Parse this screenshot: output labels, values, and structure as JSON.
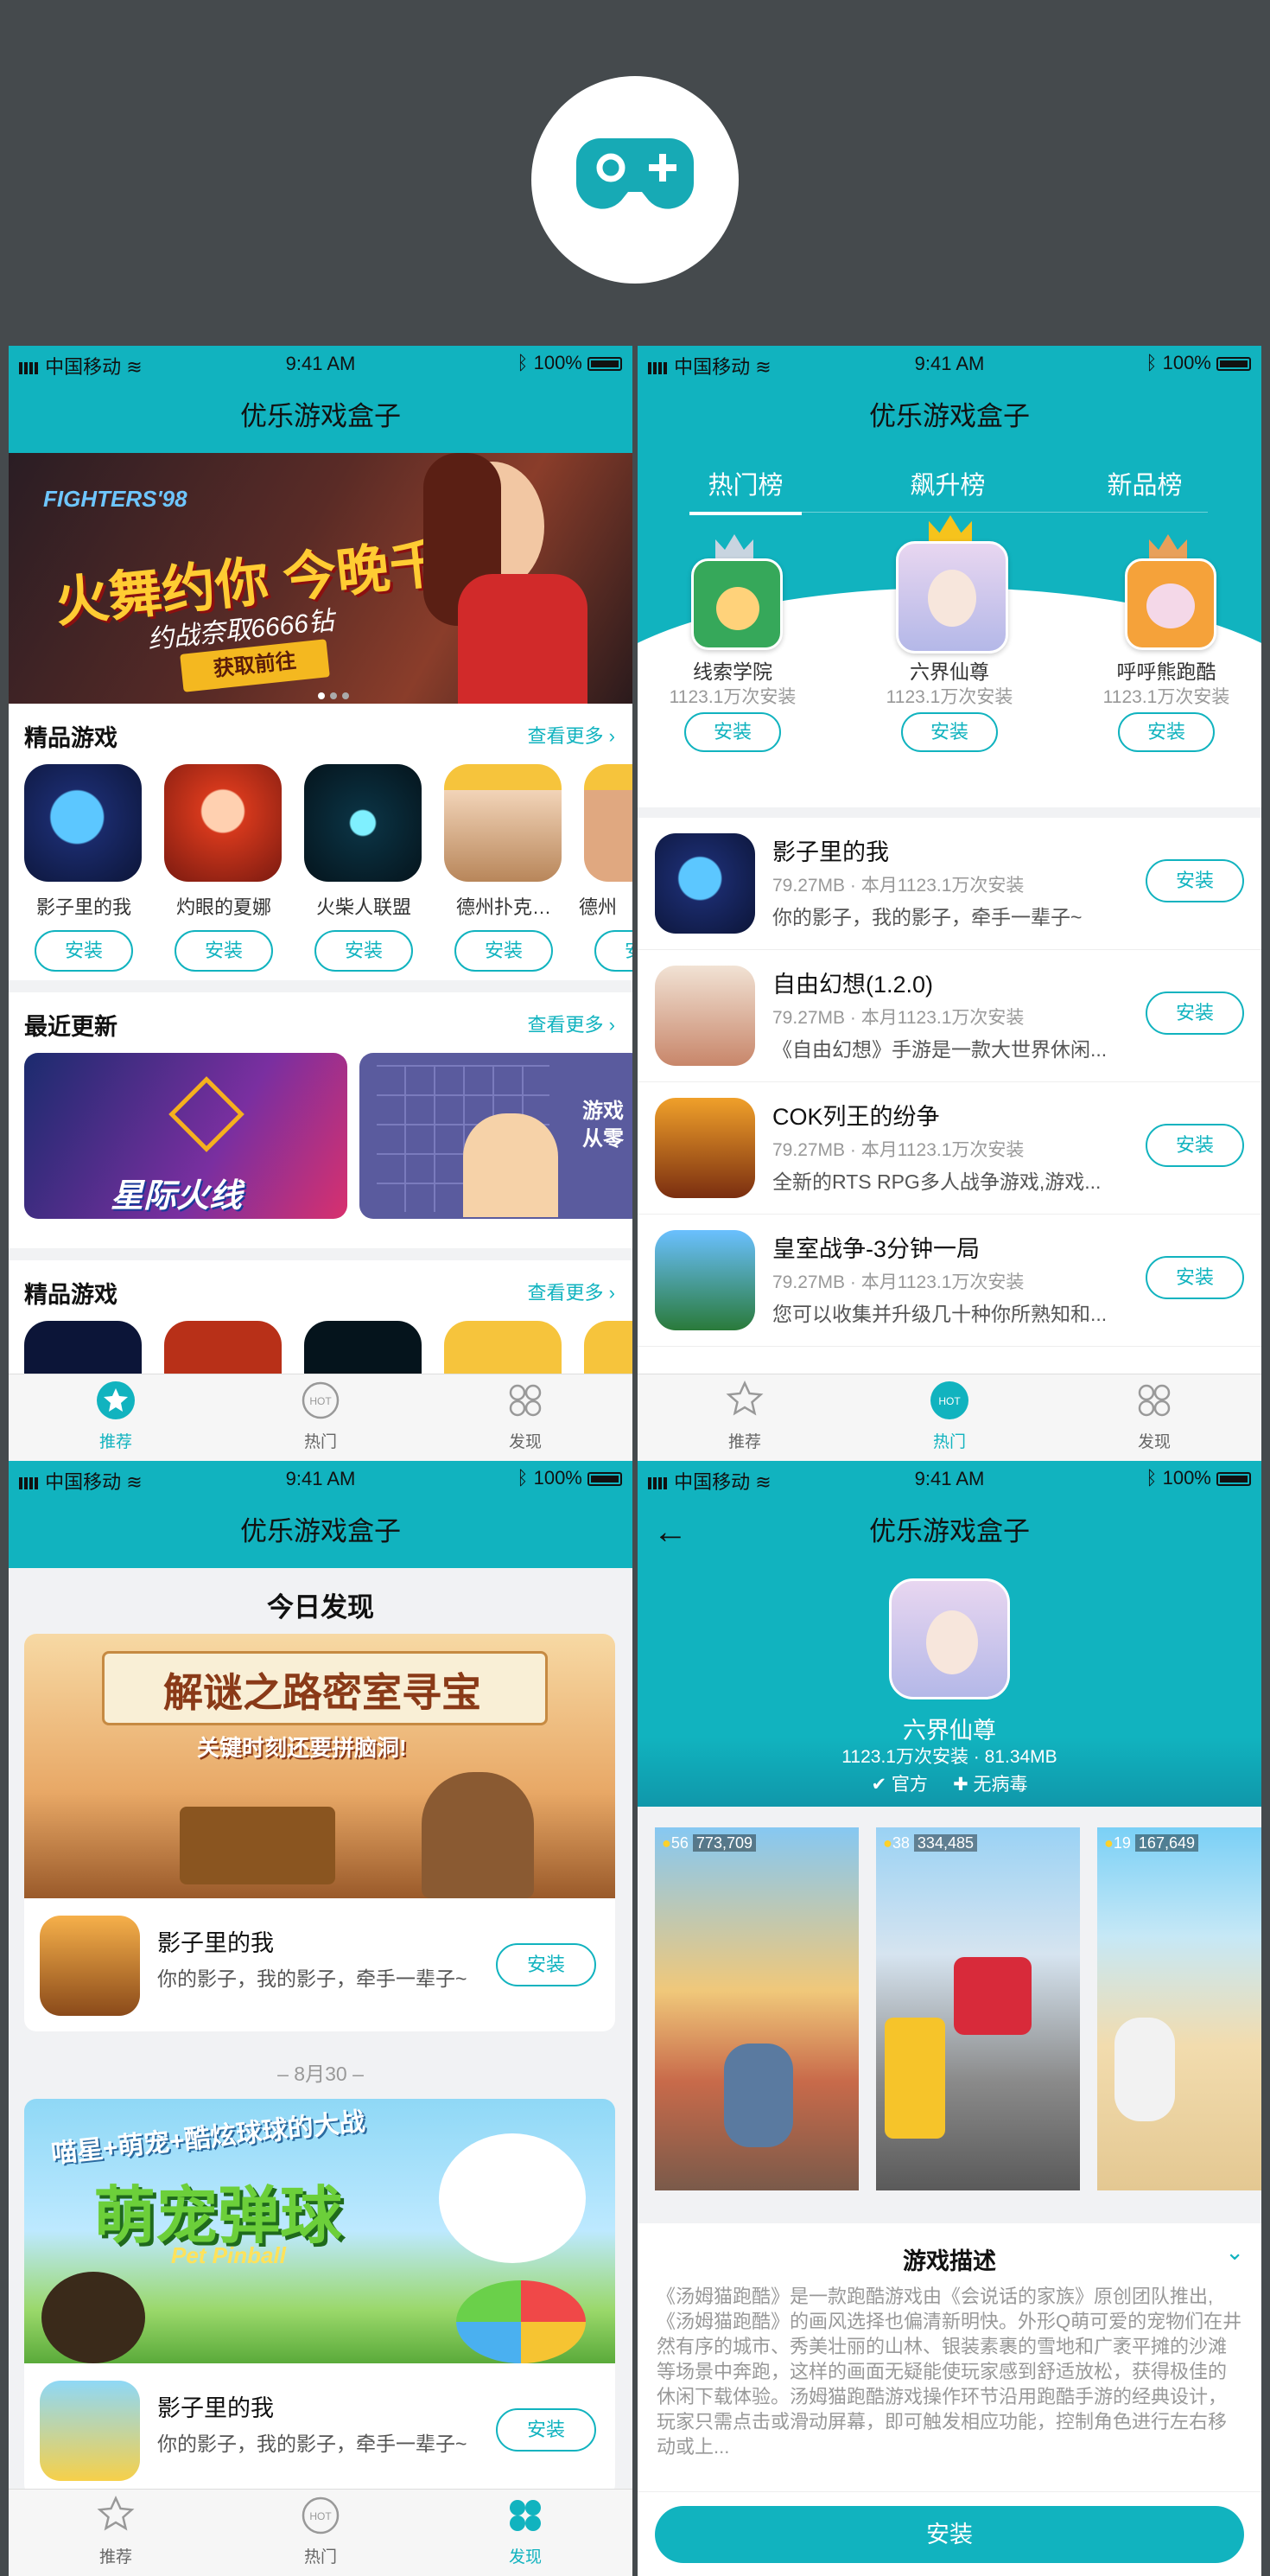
{
  "status": {
    "carrier": "中国移动",
    "time": "9:41 AM",
    "battery": "100%"
  },
  "app_title": "优乐游戏盒子",
  "install_label": "安装",
  "screen1": {
    "sections": [
      {
        "title": "精品游戏",
        "more": "查看更多"
      },
      {
        "title": "最近更新",
        "more": "查看更多"
      },
      {
        "title": "精品游戏",
        "more": "查看更多"
      }
    ],
    "banner": {
      "line1": "火舞约你 今晚千杯",
      "line2": "约战奈取6666钻",
      "button": "获取前往",
      "logo": "FIGHTERS'98"
    },
    "games": [
      "影子里的我",
      "灼眼的夏娜",
      "火柴人联盟",
      "德州扑克…",
      "德州"
    ],
    "update_cards": [
      "星际火线",
      "游戏从零"
    ]
  },
  "tabs": [
    "推荐",
    "热门",
    "发现"
  ],
  "hot_badge": "HOT",
  "screen2": {
    "tabs": [
      "热门榜",
      "飙升榜",
      "新品榜"
    ],
    "podium": [
      {
        "name": "线索学院",
        "count": "1123.1万次安装"
      },
      {
        "name": "六界仙尊",
        "count": "1123.1万次安装"
      },
      {
        "name": "呼呼熊跑酷",
        "count": "1123.1万次安装"
      }
    ],
    "list": [
      {
        "title": "影子里的我",
        "meta": "79.27MB · 本月1123.1万次安装",
        "desc": "你的影子，我的影子，牵手一辈子~"
      },
      {
        "title": "自由幻想(1.2.0)",
        "meta": "79.27MB · 本月1123.1万次安装",
        "desc": "《自由幻想》手游是一款大世界休闲..."
      },
      {
        "title": "COK列王的纷争",
        "meta": "79.27MB · 本月1123.1万次安装",
        "desc": "全新的RTS RPG多人战争游戏,游戏..."
      },
      {
        "title": "皇室战争-3分钟一局",
        "meta": "79.27MB · 本月1123.1万次安装",
        "desc": "您可以收集并升级几十种你所熟知和..."
      }
    ]
  },
  "screen3": {
    "heading": "今日发现",
    "date_divider": "– 8月30 –",
    "cards": [
      {
        "banner_text": "解谜之路密室寻宝",
        "banner_sub": "关键时刻还要拼脑洞!",
        "title": "影子里的我",
        "desc": "你的影子，我的影子，牵手一辈子~"
      },
      {
        "banner_text": "萌宠弹球",
        "banner_sub": "喵星+萌宠+酷炫球球的大战",
        "banner_en": "Pet Pinball",
        "title": "影子里的我",
        "desc": "你的影子，我的影子，牵手一辈子~"
      }
    ]
  },
  "screen4": {
    "name": "六界仙尊",
    "stats": "1123.1万次安装 · 81.34MB",
    "badges": [
      "官方",
      "无病毒"
    ],
    "shot_scores": [
      {
        "coins": "56",
        "score": "773,709"
      },
      {
        "coins": "38",
        "score": "334,485"
      },
      {
        "coins": "19",
        "score": "167,649"
      }
    ],
    "desc_title": "游戏描述",
    "desc": "《汤姆猫跑酷》是一款跑酷游戏由《会说话的家族》原创团队推出,《汤姆猫跑酷》的画风选择也偏清新明快。外形Q萌可爱的宠物们在井然有序的城市、秀美壮丽的山林、银装素裹的雪地和广袤平摊的沙滩等场景中奔跑，这样的画面无疑能使玩家感到舒适放松，获得极佳的休闲下载体验。汤姆猫跑酷游戏操作环节沿用跑酷手游的经典设计，玩家只需点击或滑动屏幕，即可触发相应功能，控制角色进行左右移动或上...",
    "install": "安装"
  }
}
